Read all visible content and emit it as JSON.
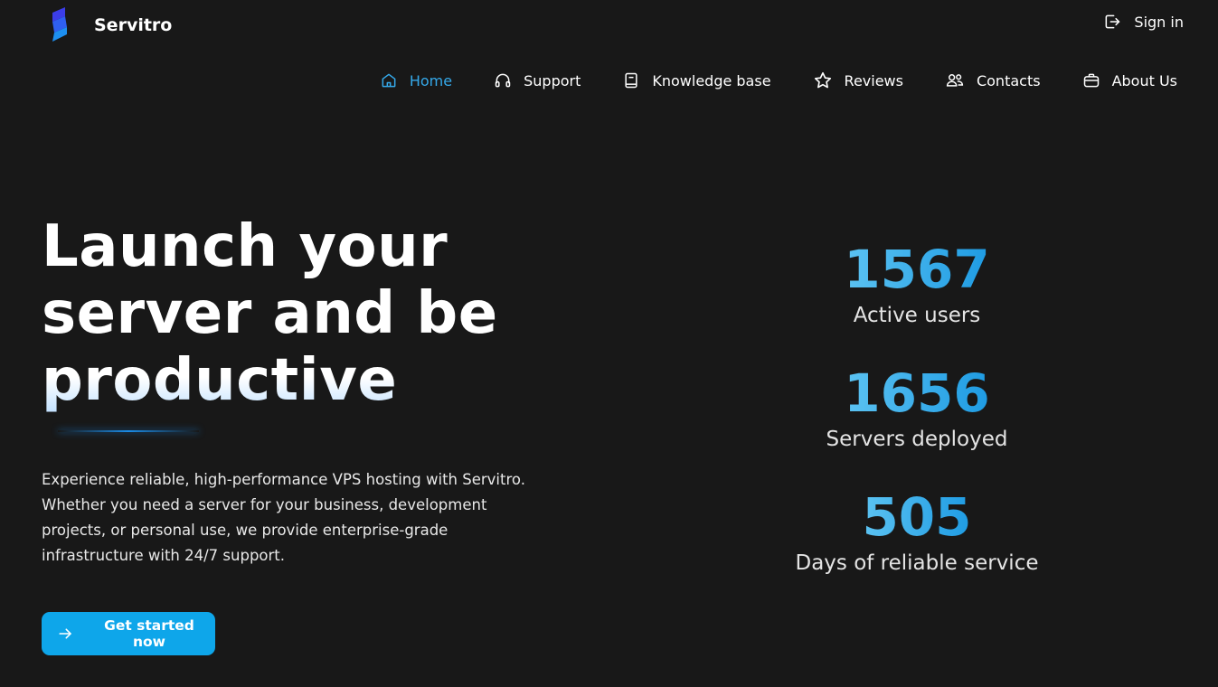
{
  "header": {
    "brand_name": "Servitro",
    "sign_in_label": "Sign in"
  },
  "nav": {
    "items": [
      {
        "label": "Home",
        "icon": "home-icon",
        "active": true
      },
      {
        "label": "Support",
        "icon": "headphones-icon"
      },
      {
        "label": "Knowledge base",
        "icon": "book-icon"
      },
      {
        "label": "Reviews",
        "icon": "star-icon"
      },
      {
        "label": "Contacts",
        "icon": "users-icon"
      },
      {
        "label": "About Us",
        "icon": "briefcase-icon"
      }
    ]
  },
  "hero": {
    "title_lines": [
      "Launch your",
      "server and be",
      "productive"
    ],
    "description": "Experience reliable, high-performance VPS hosting with Servitro. Whether you need a server for your business, development projects, or personal use, we provide enterprise-grade infrastructure with 24/7 support.",
    "cta_label": "Get started now"
  },
  "stats": [
    {
      "value": "1567",
      "label": "Active users"
    },
    {
      "value": "1656",
      "label": "Servers deployed"
    },
    {
      "value": "505",
      "label": "Days of reliable service"
    }
  ],
  "colors": {
    "background": "#181818",
    "accent": "#0ea6ea",
    "active_nav": "#35a9ea"
  }
}
